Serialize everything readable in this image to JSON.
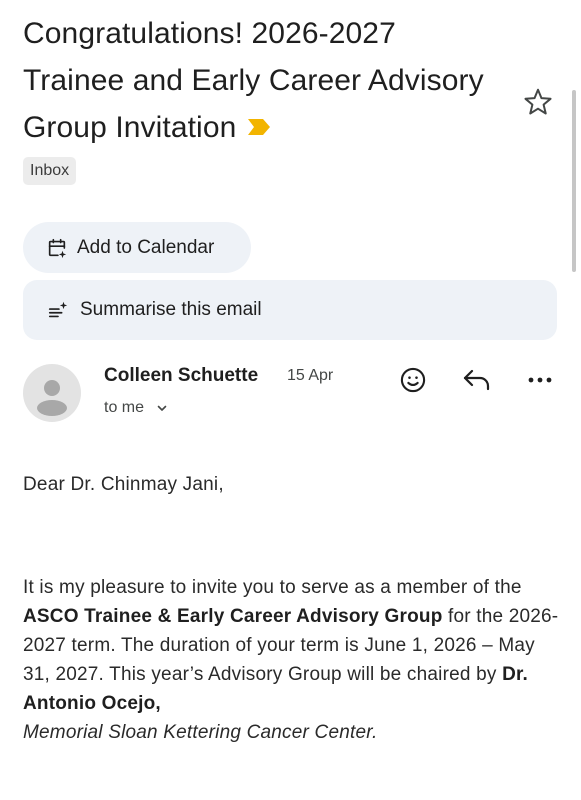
{
  "email": {
    "subject": "Congratulations! 2026-2027 Trainee and Early Career Advisory Group Invitation",
    "label": "Inbox",
    "colors": {
      "important_marker": "#f2b400",
      "pill_background": "#eef2f7"
    }
  },
  "actions": {
    "add_to_calendar": "Add to Calendar",
    "summarise": "Summarise this email"
  },
  "sender": {
    "name": "Colleen Schuette",
    "date": "15 Apr",
    "recipient_label": "to me"
  },
  "icons": [
    "star-icon",
    "calendar-sparkle-icon",
    "summarise-sparkle-icon",
    "avatar-person-icon",
    "chevron-down-icon",
    "emoji-react-icon",
    "reply-icon",
    "more-options-icon"
  ],
  "body": {
    "greeting": "Dear Dr. Chinmay Jani,",
    "p1_a": "It is my pleasure to invite you to serve as a member of the ",
    "p1_b": "ASCO Trainee & Early Career Advisory Group",
    "p1_c": " for the 2026-2027 term. The duration of your term is June 1, 2026 – May 31, 2027. This year’s Advisory Group will be chaired by ",
    "p1_d": "Dr. Antonio Ocejo,",
    "p1_e": "Memorial Sloan Kettering Cancer Center."
  }
}
